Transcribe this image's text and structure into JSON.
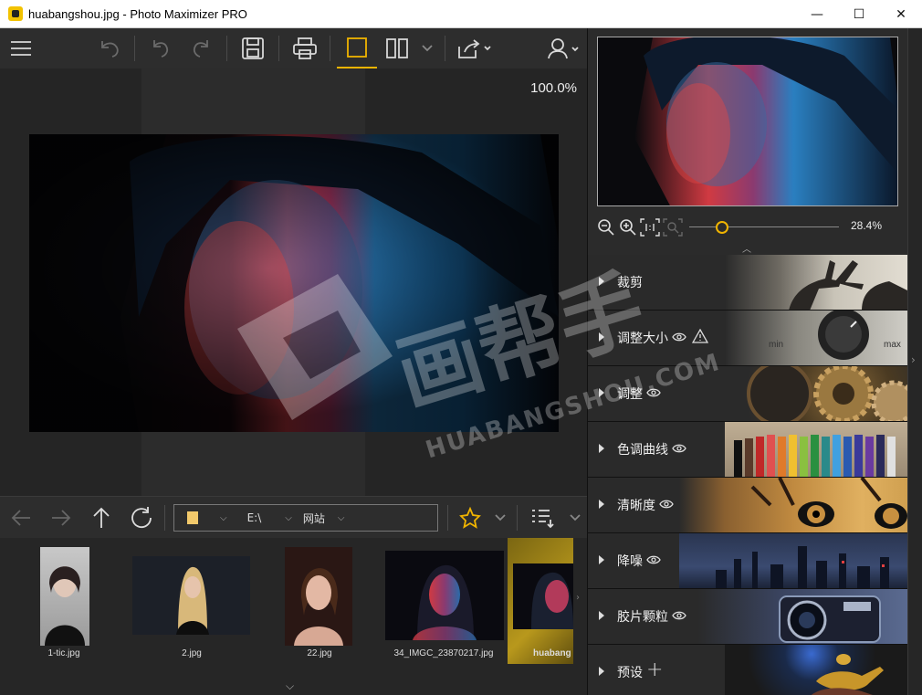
{
  "window": {
    "title": "huabangshou.jpg - Photo Maximizer PRO",
    "minimize": "—",
    "maximize": "☐",
    "close": "✕"
  },
  "toolbar": {
    "menu_icon": "hamburger-icon",
    "undo_all_icon": "undo-all-icon",
    "undo_icon": "undo-icon",
    "redo_icon": "redo-icon",
    "save_icon": "save-icon",
    "print_icon": "print-icon",
    "single_view_icon": "single-view-icon",
    "split_view_icon": "split-view-icon",
    "share_icon": "share-icon",
    "user_icon": "user-icon",
    "accent": "#f0b400"
  },
  "canvas": {
    "zoom": "100.0%"
  },
  "browser": {
    "path_drive": "E:\\",
    "path_folder": "网站"
  },
  "thumbnails": [
    {
      "name": "1-tic.jpg"
    },
    {
      "name": "2.jpg"
    },
    {
      "name": "22.jpg"
    },
    {
      "name": "34_IMGC_23870217.jpg"
    },
    {
      "name": "huabangshou.jpg",
      "visible_label": "huabang",
      "selected": true
    }
  ],
  "navigator": {
    "zoom": "28.4%",
    "slider_fraction": 0.22
  },
  "modules": [
    {
      "label": "裁剪",
      "eye": false,
      "warn": false,
      "plus": false
    },
    {
      "label": "调整大小",
      "eye": true,
      "warn": true,
      "plus": false,
      "dial_min": "min",
      "dial_max": "max"
    },
    {
      "label": "调整",
      "eye": true,
      "warn": false,
      "plus": false
    },
    {
      "label": "色调曲线",
      "eye": true,
      "warn": false,
      "plus": false
    },
    {
      "label": "清晰度",
      "eye": true,
      "warn": false,
      "plus": false
    },
    {
      "label": "降噪",
      "eye": true,
      "warn": false,
      "plus": false
    },
    {
      "label": "胶片颗粒",
      "eye": true,
      "warn": false,
      "plus": false
    },
    {
      "label": "预设",
      "eye": false,
      "warn": false,
      "plus": true
    }
  ],
  "watermark": {
    "cn": "画帮手",
    "en": "HUABANGSHOU.COM"
  }
}
